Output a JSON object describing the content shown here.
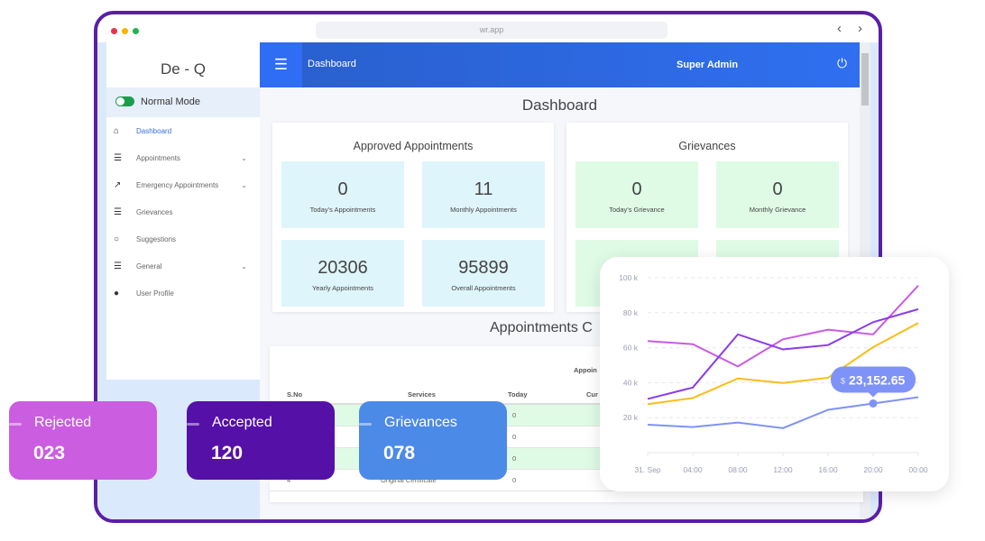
{
  "browser": {
    "url": "wr.app",
    "back": "‹",
    "forward": "›",
    "dots": [
      "#e8334a",
      "#f5b400",
      "#22b24c"
    ]
  },
  "sidebar": {
    "brand": "De - Q",
    "mode_label": "Normal Mode",
    "items": [
      {
        "label": "Dashboard",
        "icon": "home-icon",
        "glyph": "⌂",
        "active": true
      },
      {
        "label": "Appointments",
        "icon": "list-icon",
        "glyph": "☰",
        "chevron": true
      },
      {
        "label": "Emergency Appointments",
        "icon": "external-link-icon",
        "glyph": "↗",
        "chevron": true
      },
      {
        "label": "Grievances",
        "icon": "list-icon",
        "glyph": "☰"
      },
      {
        "label": "Suggestions",
        "icon": "chat-bubble-icon",
        "glyph": "○"
      },
      {
        "label": "General",
        "icon": "list-icon",
        "glyph": "☰",
        "chevron": true
      },
      {
        "label": "User Profile",
        "icon": "user-icon",
        "glyph": "●"
      }
    ]
  },
  "header": {
    "menu_icon": "☰",
    "title": "Dashboard",
    "user": "Super Admin",
    "power_icon": "⏻"
  },
  "page_title": "Dashboard",
  "approved": {
    "title": "Approved Appointments",
    "tiles": [
      {
        "value": "0",
        "label": "Today's Appointments"
      },
      {
        "value": "11",
        "label": "Monthly Appointments"
      },
      {
        "value": "20306",
        "label": "Yearly Appointments"
      },
      {
        "value": "95899",
        "label": "Overall Appointments"
      }
    ]
  },
  "grievances": {
    "title": "Grievances",
    "tiles": [
      {
        "value": "0",
        "label": "Today's Grievance"
      },
      {
        "value": "0",
        "label": "Monthly Grievance"
      }
    ]
  },
  "table": {
    "section_title": "Appointments C",
    "group_header": "Appoin",
    "columns": [
      "S.No",
      "Services",
      "Today",
      "Cur"
    ],
    "rows": [
      {
        "sno": "",
        "service": "",
        "today": "0"
      },
      {
        "sno": "",
        "service": "",
        "today": "0"
      },
      {
        "sno": "",
        "service": "",
        "today": "0"
      },
      {
        "sno": "4",
        "service": "Original Certificate",
        "today": "0"
      }
    ]
  },
  "overlays": [
    {
      "label": "Rejected",
      "value": "023",
      "color": "#cb5de0"
    },
    {
      "label": "Accepted",
      "value": "120",
      "color": "#5510a8"
    },
    {
      "label": "Grievances",
      "value": "078",
      "color": "#4c8ae8"
    }
  ],
  "chart_data": {
    "type": "line",
    "categories": [
      "31. Sep",
      "04:00",
      "08:00",
      "12:00",
      "16:00",
      "20:00",
      "00:00"
    ],
    "yticks": [
      "20 k",
      "40 k",
      "60 k",
      "80 k",
      "100 k"
    ],
    "ylim": [
      0,
      100000
    ],
    "grid": true,
    "series": [
      {
        "color": "#c95ae6",
        "values": [
          63800,
          62000,
          49300,
          64800,
          70300,
          67600,
          95500
        ]
      },
      {
        "color": "#8a3ce8",
        "values": [
          30700,
          37200,
          67600,
          59000,
          61500,
          74600,
          82000
        ]
      },
      {
        "color": "#fbbd17",
        "values": [
          27700,
          31200,
          42400,
          39800,
          42800,
          60300,
          74100
        ]
      },
      {
        "color": "#7f92f7",
        "values": [
          16000,
          14600,
          17200,
          14000,
          24500,
          28100,
          31700
        ]
      }
    ],
    "tooltip": {
      "currency": "$",
      "value": "23,152.65",
      "series_index": 3,
      "point_index": 5
    }
  }
}
